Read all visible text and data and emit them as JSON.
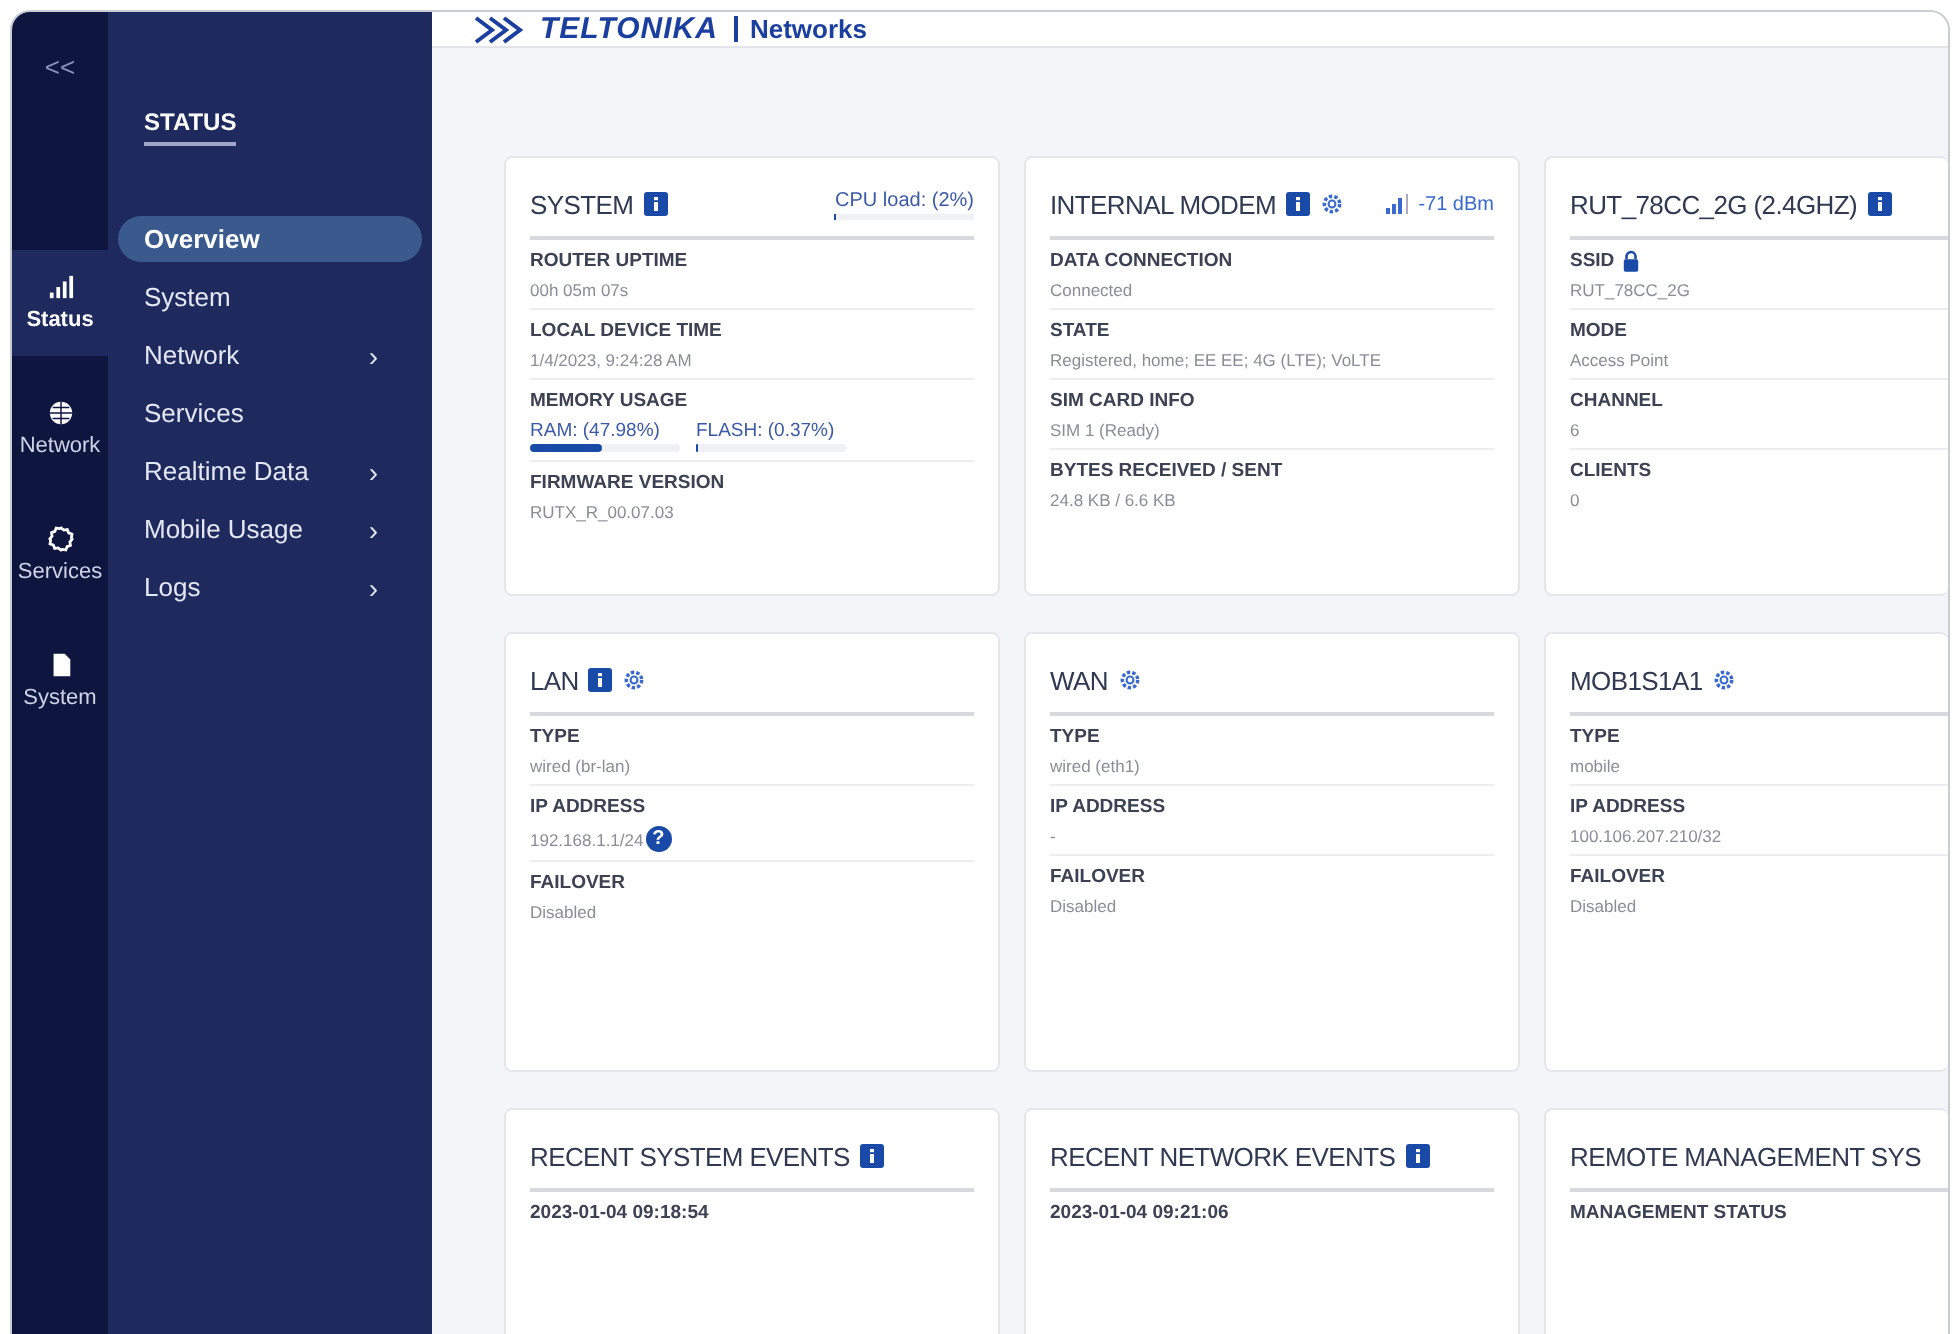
{
  "sidebar": {
    "collapse": "<<",
    "rail": [
      {
        "label": "Status",
        "kind": "signal",
        "selected": true
      },
      {
        "label": "Network",
        "kind": "globe",
        "selected": false
      },
      {
        "label": "Services",
        "kind": "gear",
        "selected": false
      },
      {
        "label": "System",
        "kind": "file",
        "selected": false
      }
    ],
    "section_title": "STATUS",
    "nav": [
      {
        "label": "Overview",
        "selected": true
      },
      {
        "label": "System",
        "selected": false
      },
      {
        "label": "Network",
        "selected": false,
        "chevron": "›"
      },
      {
        "label": "Services",
        "selected": false
      },
      {
        "label": "Realtime Data",
        "selected": false,
        "chevron": "›"
      },
      {
        "label": "Mobile Usage",
        "selected": false,
        "chevron": "›"
      },
      {
        "label": "Logs",
        "selected": false,
        "chevron": "›"
      }
    ]
  },
  "header": {
    "brand": "TELTONIKA",
    "product": "Networks"
  },
  "card_rows": [
    [
      {
        "title": "SYSTEM",
        "info": true,
        "gear": false,
        "header_right": {
          "kind": "cpu",
          "text": "CPU load: (2%)",
          "level": 0.02
        },
        "fields": [
          {
            "kind": "text",
            "label": "ROUTER UPTIME",
            "value": "00h 05m 07s"
          },
          {
            "kind": "text",
            "label": "LOCAL DEVICE TIME",
            "value": "1/4/2023, 9:24:28 AM"
          },
          {
            "kind": "meters",
            "label": "MEMORY USAGE",
            "meters": [
              {
                "text": "RAM: (47.98%)",
                "level": 0.48
              },
              {
                "text": "FLASH: (0.37%)",
                "level": 0.0037
              }
            ]
          },
          {
            "kind": "text",
            "label": "FIRMWARE VERSION",
            "value": "RUTX_R_00.07.03"
          }
        ]
      },
      {
        "title": "INTERNAL MODEM",
        "info": true,
        "gear": true,
        "header_right": {
          "kind": "signal",
          "text": "-71 dBm"
        },
        "fields": [
          {
            "kind": "text",
            "label": "DATA CONNECTION",
            "value": "Connected"
          },
          {
            "kind": "text",
            "label": "STATE",
            "value": "Registered, home; EE EE; 4G (LTE); VoLTE"
          },
          {
            "kind": "text",
            "label": "SIM CARD INFO",
            "value": "SIM 1 (Ready)"
          },
          {
            "kind": "text",
            "label": "BYTES RECEIVED / SENT",
            "value": "24.8 KB / 6.6 KB"
          }
        ]
      },
      {
        "title": "RUT_78CC_2G (2.4GHZ)",
        "info": true,
        "gear": false,
        "fields": [
          {
            "kind": "text",
            "label": "SSID",
            "locked": true,
            "value": "RUT_78CC_2G"
          },
          {
            "kind": "text",
            "label": "MODE",
            "value": "Access Point"
          },
          {
            "kind": "text",
            "label": "CHANNEL",
            "value": "6"
          },
          {
            "kind": "text",
            "label": "CLIENTS",
            "value": "0"
          }
        ]
      }
    ],
    [
      {
        "title": "LAN",
        "info": true,
        "gear": true,
        "fields": [
          {
            "kind": "text",
            "label": "TYPE",
            "value": "wired (br-lan)"
          },
          {
            "kind": "text",
            "label": "IP ADDRESS",
            "value": "192.168.1.1/24",
            "help": "?"
          },
          {
            "kind": "text",
            "label": "FAILOVER",
            "value": "Disabled"
          }
        ]
      },
      {
        "title": "WAN",
        "info": false,
        "gear": true,
        "fields": [
          {
            "kind": "text",
            "label": "TYPE",
            "value": "wired (eth1)"
          },
          {
            "kind": "text",
            "label": "IP ADDRESS",
            "value": "-"
          },
          {
            "kind": "text",
            "label": "FAILOVER",
            "value": "Disabled"
          }
        ]
      },
      {
        "title": "MOB1S1A1",
        "info": false,
        "gear": true,
        "fields": [
          {
            "kind": "text",
            "label": "TYPE",
            "value": "mobile"
          },
          {
            "kind": "text",
            "label": "IP ADDRESS",
            "value": "100.106.207.210/32"
          },
          {
            "kind": "text",
            "label": "FAILOVER",
            "value": "Disabled"
          }
        ]
      }
    ],
    [
      {
        "title": "RECENT SYSTEM EVENTS",
        "info": true,
        "gear": false,
        "fields": [
          {
            "kind": "text",
            "label": "2023-01-04 09:18:54"
          }
        ]
      },
      {
        "title": "RECENT NETWORK EVENTS",
        "info": true,
        "gear": false,
        "fields": [
          {
            "kind": "text",
            "label": "2023-01-04 09:21:06"
          }
        ]
      },
      {
        "title": "REMOTE MANAGEMENT SYS",
        "info": false,
        "gear": false,
        "fields": [
          {
            "kind": "text",
            "label": "MANAGEMENT STATUS"
          }
        ]
      }
    ]
  ]
}
